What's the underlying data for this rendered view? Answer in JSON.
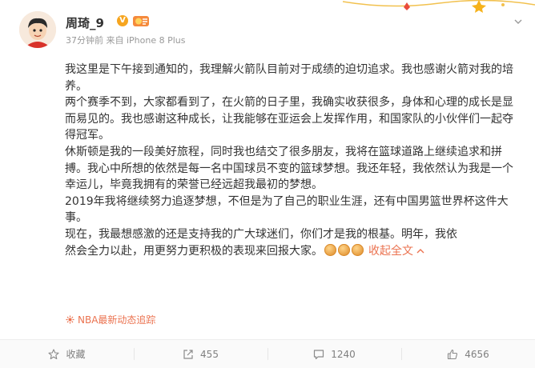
{
  "post": {
    "author": "周琦_9",
    "verified_badge": "V",
    "meta": "37分钟前 来自 iPhone 8 Plus",
    "paragraphs": [
      "我这里是下午接到通知的，我理解火箭队目前对于成绩的迫切追求。我也感谢火箭对我的培养。",
      "两个赛季不到，大家都看到了，在火箭的日子里，我确实收获很多，身体和心理的成长是显而易见的。我也感谢这种成长，让我能够在亚运会上发挥作用，和国家队的小伙伴们一起夺得冠军。",
      "休斯顿是我的一段美好旅程，同时我也结交了很多朋友，我将在篮球道路上继续追求和拼搏。我心中所想的依然是每一名中国球员不变的篮球梦想。我还年轻，我依然认为我是一个幸运儿，毕竟我拥有的荣誉已经远超我最初的梦想。",
      "2019年我将继续努力追逐梦想，不但是为了自己的职业生涯，还有中国男篮世界杯这件大事。"
    ],
    "last_line_1": "现在，我最想感激的还是支持我的广大球迷们，你们才是我的根基。明年，我依",
    "last_line_2": "然会全力以赴，用更努力更积极的表现来回报大家。",
    "collapse_label": "收起全文",
    "topic": "NBA最新动态追踪"
  },
  "actions": {
    "favorite": "收藏",
    "repost": "455",
    "comment": "1240",
    "like": "4656"
  },
  "colors": {
    "accent": "#eb7350",
    "meta": "#999999",
    "text": "#333333",
    "badge": "#f6a51f"
  },
  "icons": [
    "avatar",
    "verified-badge",
    "medal-icon",
    "chevron-down-icon",
    "clap-emoji",
    "chevron-up-icon",
    "tag-icon",
    "star-icon",
    "repost-icon",
    "comment-icon",
    "like-icon"
  ]
}
